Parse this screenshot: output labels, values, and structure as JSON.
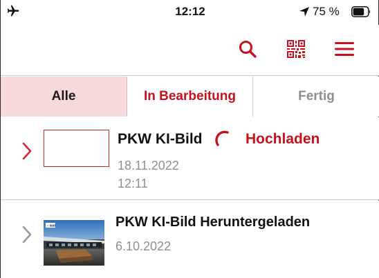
{
  "status_bar": {
    "time": "12:12",
    "battery_percent": "75 %",
    "airplane_icon": "airplane-icon",
    "location_icon": "location-arrow-icon",
    "battery_icon": "battery-icon"
  },
  "header": {
    "actions": [
      {
        "icon": "search-icon"
      },
      {
        "icon": "qr-code-icon"
      },
      {
        "icon": "hamburger-menu-icon"
      }
    ]
  },
  "tabs": [
    {
      "label": "Alle",
      "active": true
    },
    {
      "label": "In Bearbeitung",
      "active": false
    },
    {
      "label": "Fertig",
      "active": false
    }
  ],
  "items": [
    {
      "title": "PKW KI-Bild",
      "status": "Hochladen",
      "date": "18.11.2022",
      "time": "12:11",
      "thumbnail": "empty-placeholder",
      "chevron_color": "#d3262e"
    },
    {
      "title": "PKW KI-Bild Heruntergeladen",
      "date": "6.10.2022",
      "thumbnail": "building-photo",
      "chevron_color": "#9a9a9a"
    }
  ],
  "colors": {
    "accent": "#c7101c",
    "active_tab_bg": "#f8d9d9",
    "muted_text": "#8e8e8e"
  }
}
